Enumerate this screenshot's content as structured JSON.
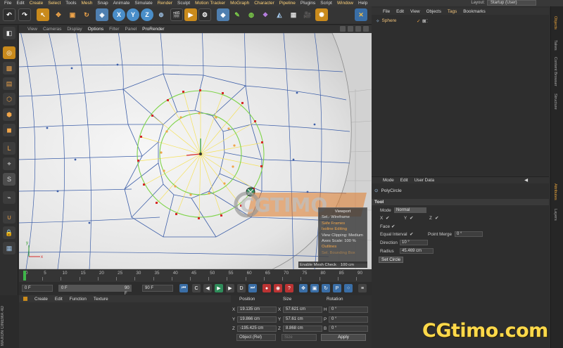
{
  "menubar": {
    "items": [
      "File",
      "Edit",
      "Create",
      "Select",
      "Tools",
      "Mesh",
      "Snap",
      "Animate",
      "Simulate",
      "Render",
      "Sculpt",
      "Motion Tracker",
      "MoGraph",
      "Character",
      "Pipeline",
      "Plugins",
      "Script",
      "Window",
      "Help"
    ],
    "layout_label": "Layout:",
    "layout_value": "Startup (User)"
  },
  "toolbar": {
    "axis_x": "X",
    "axis_y": "Y",
    "axis_z": "Z"
  },
  "viewport_menu": {
    "items": [
      "View",
      "Cameras",
      "Display",
      "Options",
      "Filter",
      "Panel",
      "ProRender"
    ]
  },
  "hud": {
    "title": "Viewport",
    "sel": "Sel.: Wireframe",
    "safe": "Safe Frames",
    "isoline": "Isoline Editing",
    "clipping": "View Clipping: Medium",
    "axes": "Axes Scale:   100 %",
    "outlines": "Outlines",
    "bounding": "Sel. Bounding Box"
  },
  "enable_bar": {
    "label": "Enable Mesh Check",
    "value": "100 cm"
  },
  "watermark": "CGTIMO",
  "timeline": {
    "ticks": [
      "0",
      "5",
      "10",
      "15",
      "20",
      "25",
      "30",
      "35",
      "40",
      "45",
      "50",
      "55",
      "60",
      "65",
      "70",
      "75",
      "80",
      "85",
      "90"
    ],
    "current": "0 F",
    "start": "0 F",
    "end": "90 F",
    "max": "90 F",
    "end2": "0 F"
  },
  "bottom_left_menu": [
    "Create",
    "Edit",
    "Function",
    "Texture"
  ],
  "coords": {
    "headers": [
      "Position",
      "Size",
      "Rotation"
    ],
    "rows": [
      {
        "axis": "X",
        "pos": "19.135 cm",
        "size_axis": "X",
        "size": "57.621 cm",
        "rot_axis": "H",
        "rot": "0 °"
      },
      {
        "axis": "Y",
        "pos": "19.866 cm",
        "size_axis": "Y",
        "size": "57.61 cm",
        "rot_axis": "P",
        "rot": "0 °"
      },
      {
        "axis": "Z",
        "pos": "-195.425 cm",
        "size_axis": "Z",
        "size": "8.868 cm",
        "rot_axis": "B",
        "rot": "0 °"
      }
    ],
    "mode": "Object (Rel)",
    "size_mode": "Size",
    "apply": "Apply"
  },
  "object_manager": {
    "menu": [
      "File",
      "Edit",
      "View",
      "Objects",
      "Tags",
      "Bookmarks"
    ],
    "active_menu": "Tags",
    "object": "Sphere"
  },
  "side_tabs": {
    "top": [
      "Objects",
      "Takes",
      "Content Browser",
      "Structure"
    ],
    "bottom": [
      "Attributes",
      "Layers"
    ]
  },
  "attributes": {
    "menu": [
      "Mode",
      "Edit",
      "User Data"
    ],
    "title": "PolyCircle",
    "section": "Tool",
    "mode_label": "Mode",
    "mode_value": "Normal",
    "x_label": "X",
    "y_label": "Y",
    "z_label": "Z",
    "face_label": "Face",
    "equal_label": "Equal Interval",
    "point_merge_label": "Point Merge",
    "point_merge_value": "0 °",
    "direction_label": "Direction",
    "direction_value": "10 °",
    "radius_label": "Radius",
    "radius_value": "45.469 cm",
    "set_circle": "Set Circle",
    "check": "✔"
  },
  "brand": "CGtimo.com",
  "maxon": "MAXON CINEMA 4D",
  "colors": {
    "accent": "#c98a1c",
    "highlight_menu": "#ffd37a",
    "hud_orange": "#f0a54a",
    "brand_yellow": "#ffd94a",
    "circle_green": "#7fd44a",
    "spoke_yellow": "#f5e15a",
    "wire_blue": "#3c5ea8"
  }
}
